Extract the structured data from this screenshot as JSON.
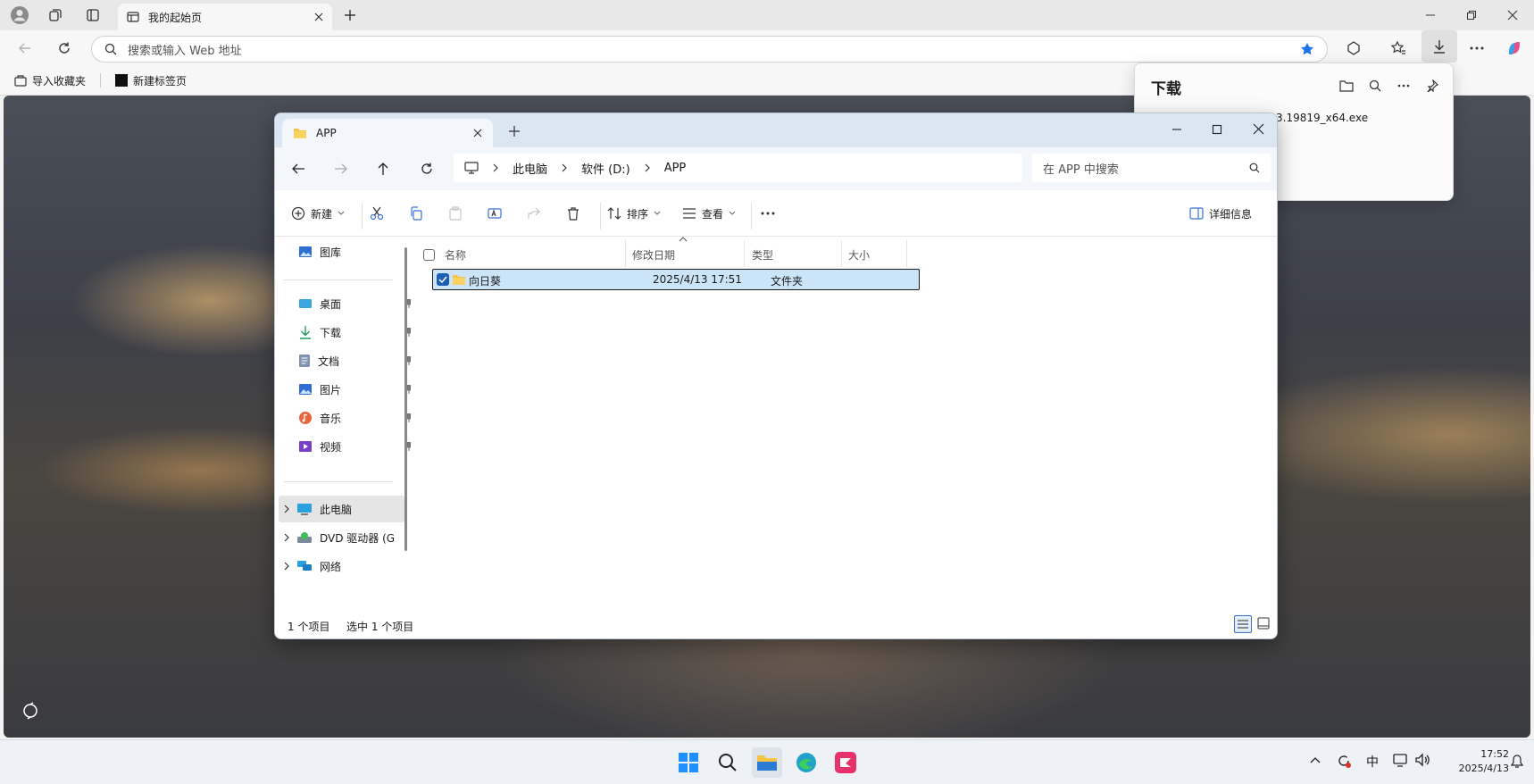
{
  "browser": {
    "tab_title": "我的起始页",
    "address_placeholder": "搜索或输入 Web 地址",
    "bookmarks": [
      "导入收藏夹",
      "新建标签页"
    ]
  },
  "downloads": {
    "title": "下载",
    "file_name_fragment": "3.19819_x64.exe"
  },
  "explorer": {
    "tab_title": "APP",
    "breadcrumbs": [
      "此电脑",
      "软件 (D:)",
      "APP"
    ],
    "search_placeholder": "在 APP 中搜索",
    "toolbar": {
      "new_label": "新建",
      "sort_label": "排序",
      "view_label": "查看",
      "details_label": "详细信息"
    },
    "sidebar": {
      "gallery": "图库",
      "pinned": [
        "桌面",
        "下载",
        "文档",
        "图片",
        "音乐",
        "视频"
      ],
      "drives": [
        "此电脑",
        "DVD 驱动器 (G",
        "网络"
      ]
    },
    "columns": [
      "名称",
      "修改日期",
      "类型",
      "大小"
    ],
    "rows": [
      {
        "name": "向日葵",
        "modified": "2025/4/13 17:51",
        "type": "文件夹",
        "size": ""
      }
    ],
    "status": {
      "count": "1 个项目",
      "selected": "选中 1 个项目"
    }
  },
  "taskbar": {
    "ime": "中",
    "time": "17:52",
    "date": "2025/4/13"
  }
}
